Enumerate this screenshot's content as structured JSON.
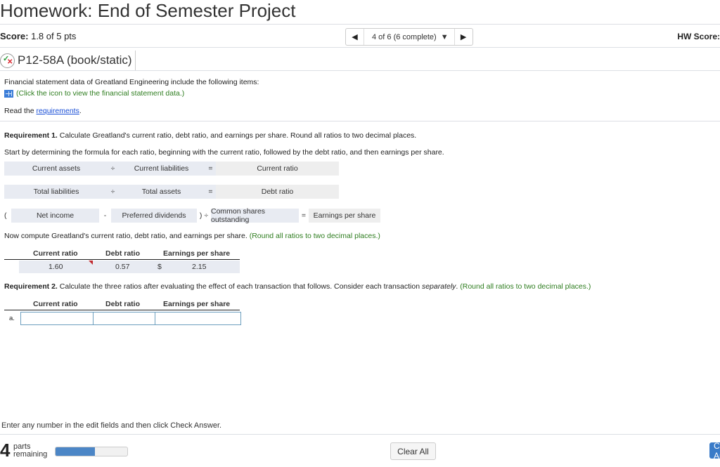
{
  "header": {
    "title": "Homework: End of Semester Project",
    "score_label": "Score:",
    "score_value": "1.8 of 5 pts",
    "nav_position": "4 of 6 (6 complete)",
    "hw_score_label": "HW Score:"
  },
  "question": {
    "id": "P12-58A (book/static)",
    "status_icon": "partial-correct-icon",
    "intro": "Financial statement data of Greatland Engineering include the following items:",
    "data_link": "(Click the icon to view the financial statement data.)",
    "read_prefix": "Read the ",
    "requirements_link": "requirements",
    "read_suffix": "."
  },
  "req1": {
    "label": "Requirement 1.",
    "text": " Calculate Greatland's current ratio, debt ratio, and earnings per share. Round all ratios to two decimal places.",
    "instructions": "Start by determining the formula for each ratio, beginning with the current ratio, followed by the debt ratio, and then earnings per share.",
    "formulas": {
      "current": {
        "a": "Current assets",
        "op": "÷",
        "b": "Current liabilities",
        "eq": "=",
        "result": "Current ratio"
      },
      "debt": {
        "a": "Total liabilities",
        "op": "÷",
        "b": "Total assets",
        "eq": "=",
        "result": "Debt ratio"
      },
      "eps": {
        "open": "(",
        "a": "Net income",
        "op": "-",
        "b": "Preferred dividends",
        "close": ") ÷",
        "c": "Common shares outstanding",
        "eq": "=",
        "result": "Earnings per share"
      }
    },
    "compute_text": "Now compute Greatland's current ratio, debt ratio, and earnings per share. ",
    "compute_hint": "(Round all ratios to two decimal places.)",
    "table_headers": [
      "Current ratio",
      "Debt ratio",
      "Earnings per share"
    ],
    "answers": {
      "current_ratio": "1.60",
      "debt_ratio": "0.57",
      "currency": "$",
      "eps": "2.15"
    }
  },
  "req2": {
    "label": "Requirement 2.",
    "text": " Calculate the three ratios after evaluating the effect of each transaction that follows. Consider each transaction ",
    "emph": "separately",
    "text_end": ". ",
    "hint": "(Round all ratios to two decimal places.)",
    "table_headers": [
      "Current ratio",
      "Debt ratio",
      "Earnings per share"
    ],
    "rows": [
      {
        "label": "a.",
        "current_ratio": "",
        "debt_ratio": "",
        "eps": ""
      }
    ]
  },
  "footer": {
    "hint": "Enter any number in the edit fields and then click Check Answer.",
    "parts_count": "4",
    "parts_label_1": "parts",
    "parts_label_2": "remaining",
    "progress_fraction": 0.55,
    "clear_all": "Clear All",
    "check_answer": "Check Answer"
  }
}
